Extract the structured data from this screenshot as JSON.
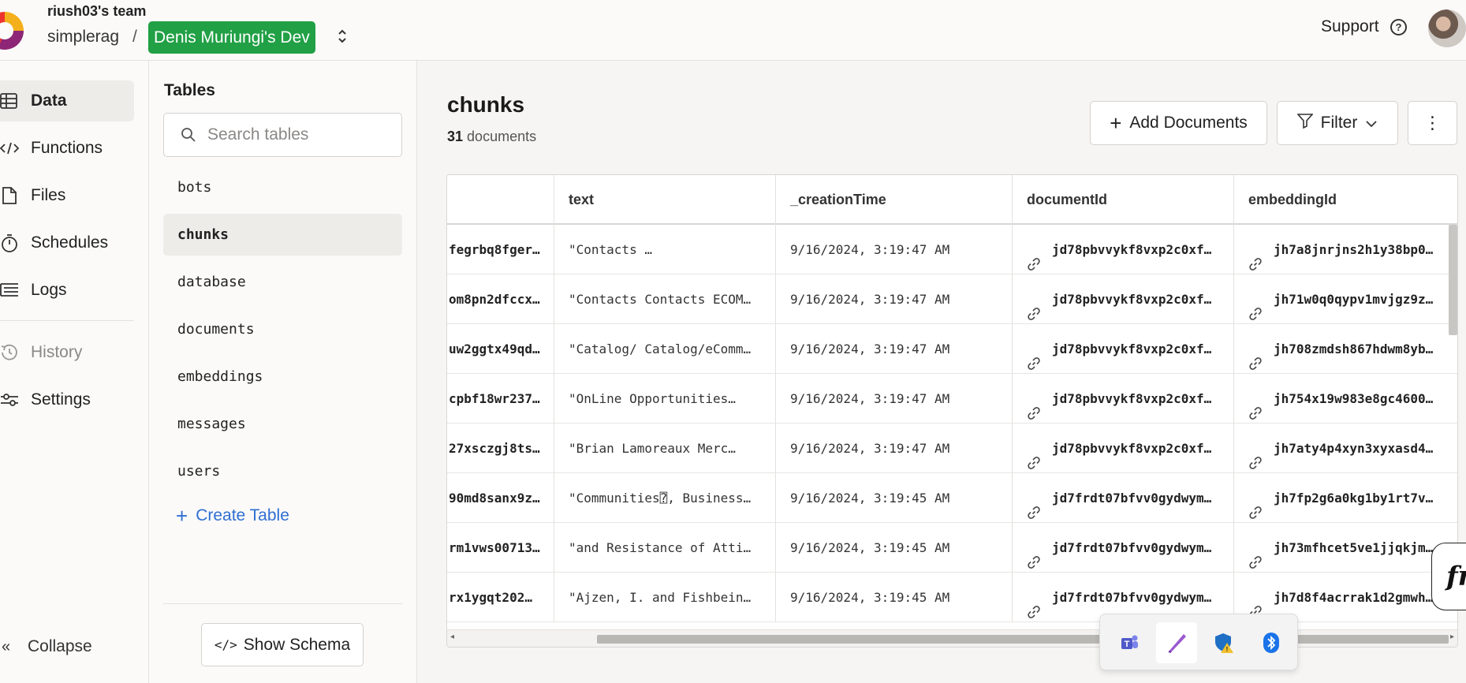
{
  "header": {
    "team": "riush03's team",
    "project": "simplerag",
    "separator": "/",
    "deployment": "Denis Muriungi's Dev",
    "support": "Support",
    "help_icon": "?",
    "switcher_icon": "chevron-up-down-icon",
    "brand_color": "#21a045"
  },
  "nav": {
    "items": [
      {
        "label": "Data",
        "icon": "table-icon"
      },
      {
        "label": "Functions",
        "icon": "code-icon"
      },
      {
        "label": "Files",
        "icon": "file-icon"
      },
      {
        "label": "Schedules",
        "icon": "stopwatch-icon"
      },
      {
        "label": "Logs",
        "icon": "logs-icon"
      },
      {
        "label": "History",
        "icon": "history-icon"
      },
      {
        "label": "Settings",
        "icon": "sliders-icon"
      }
    ],
    "collapse": "Collapse"
  },
  "tables": {
    "title": "Tables",
    "search_placeholder": "Search tables",
    "items": [
      "bots",
      "chunks",
      "database",
      "documents",
      "embeddings",
      "messages",
      "users"
    ],
    "create": "Create Table",
    "show_schema": "Show Schema"
  },
  "main": {
    "title": "chunks",
    "count": "31",
    "count_label": "documents",
    "add": "Add Documents",
    "filter": "Filter",
    "more": "⋮"
  },
  "grid": {
    "columns": [
      "",
      "text",
      "_creationTime",
      "documentId",
      "embeddingId"
    ],
    "rows": [
      {
        "id": "fegrbq8fger…",
        "text": "\"Contacts           …",
        "time": "9/16/2024, 3:19:47 AM",
        "doc": "jd78pbvvykf8vxp2c0xf…",
        "emb": "jh7a8jnrjns2h1y38bp0…"
      },
      {
        "id": "om8pn2dfccx…",
        "text": "\"Contacts Contacts ECOM…",
        "time": "9/16/2024, 3:19:47 AM",
        "doc": "jd78pbvvykf8vxp2c0xf…",
        "emb": "jh71w0q0qypv1mvjgz9z…"
      },
      {
        "id": "uw2ggtx49qd…",
        "text": "\"Catalog/ Catalog/eComm…",
        "time": "9/16/2024, 3:19:47 AM",
        "doc": "jd78pbvvykf8vxp2c0xf…",
        "emb": "jh708zmdsh867hdwm8yb…"
      },
      {
        "id": "cpbf18wr237…",
        "text": "\"OnLine   Opportunities…",
        "time": "9/16/2024, 3:19:47 AM",
        "doc": "jd78pbvvykf8vxp2c0xf…",
        "emb": "jh754x19w983e8gc4600…"
      },
      {
        "id": "27xsczgj8ts…",
        "text": "\"Brian   Lamoreaux Merc…",
        "time": "9/16/2024, 3:19:47 AM",
        "doc": "jd78pbvvykf8vxp2c0xf…",
        "emb": "jh7aty4p4xyn3xyxasd4…"
      },
      {
        "id": "90md8sanx9z…",
        "text": "\"Communities⍰, Business…",
        "time": "9/16/2024, 3:19:45 AM",
        "doc": "jd7frdt07bfvv0gydwym…",
        "emb": "jh7fp2g6a0kg1by1rt7v…"
      },
      {
        "id": "rm1vws00713…",
        "text": "\"and Resistance of Atti…",
        "time": "9/16/2024, 3:19:45 AM",
        "doc": "jd7frdt07bfvv0gydwym…",
        "emb": "jh73mfhcet5ve1jjqkjm…"
      },
      {
        "id": "rx1ygqt202…",
        "text": "\"Ajzen, I. and Fishbein…",
        "time": "9/16/2024, 3:19:45 AM",
        "doc": "jd7frdt07bfvv0gydwym…",
        "emb": "jh7d8f4acrrak1d2gmwh…"
      }
    ]
  },
  "floating": {
    "fn": "fr"
  },
  "tray": {
    "icons": [
      "teams-icon",
      "pen-icon",
      "security-warning-icon",
      "bluetooth-icon"
    ]
  }
}
